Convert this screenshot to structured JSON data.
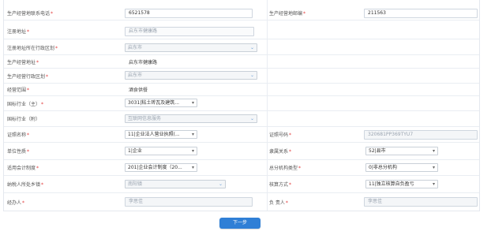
{
  "rows": {
    "contact_phone": {
      "label": "生产经营地联系电话",
      "value": "6521578"
    },
    "postcode": {
      "label": "生产经营地邮编",
      "value": "211563"
    },
    "reg_address": {
      "label": "注册地址",
      "value": "启东市健康路"
    },
    "reg_region": {
      "label": "注册地址所在行政区划",
      "value": "启东市"
    },
    "prod_address": {
      "label": "生产经营地址",
      "value": "启东市健康路"
    },
    "prod_region": {
      "label": "生产经营行政区划",
      "value": "启东市"
    },
    "scope": {
      "label": "经营范围",
      "value": "酒食供餐"
    },
    "industry_main": {
      "label": "国标行业（主）",
      "value": "3031|粘土砖瓦及建筑..."
    },
    "industry_sub": {
      "label": "国标行业（附）",
      "value": "互联网信息服务"
    },
    "cert_name": {
      "label": "证照名称",
      "value": "11|企业法人营业执照(..."
    },
    "cert_no": {
      "label": "证照号码",
      "value": "320681PP369TYU7"
    },
    "unit_nature": {
      "label": "单位性质",
      "value": "1|企业"
    },
    "affiliation": {
      "label": "隶属关系",
      "value": "52|县市"
    },
    "accounting": {
      "label": "适用会计制度",
      "value": "201|企业会计制度（20..."
    },
    "branch_type": {
      "label": "总分机构类型",
      "value": "0|非总分机构"
    },
    "taxpayer_town": {
      "label": "纳税人所处乡镇",
      "value": "南阳镇"
    },
    "accounting_method": {
      "label": "核算方式",
      "value": "11|独立核算自负盈亏"
    },
    "handler": {
      "label": "经办人",
      "value": "李思佳"
    },
    "person_in_charge": {
      "label": "负 责人",
      "value": "李思佳"
    }
  },
  "required_mark": "*",
  "next_button": "下一步",
  "colors": {
    "accent": "#2f7fd6",
    "required": "#e03a3a",
    "border": "#cfd6df"
  }
}
